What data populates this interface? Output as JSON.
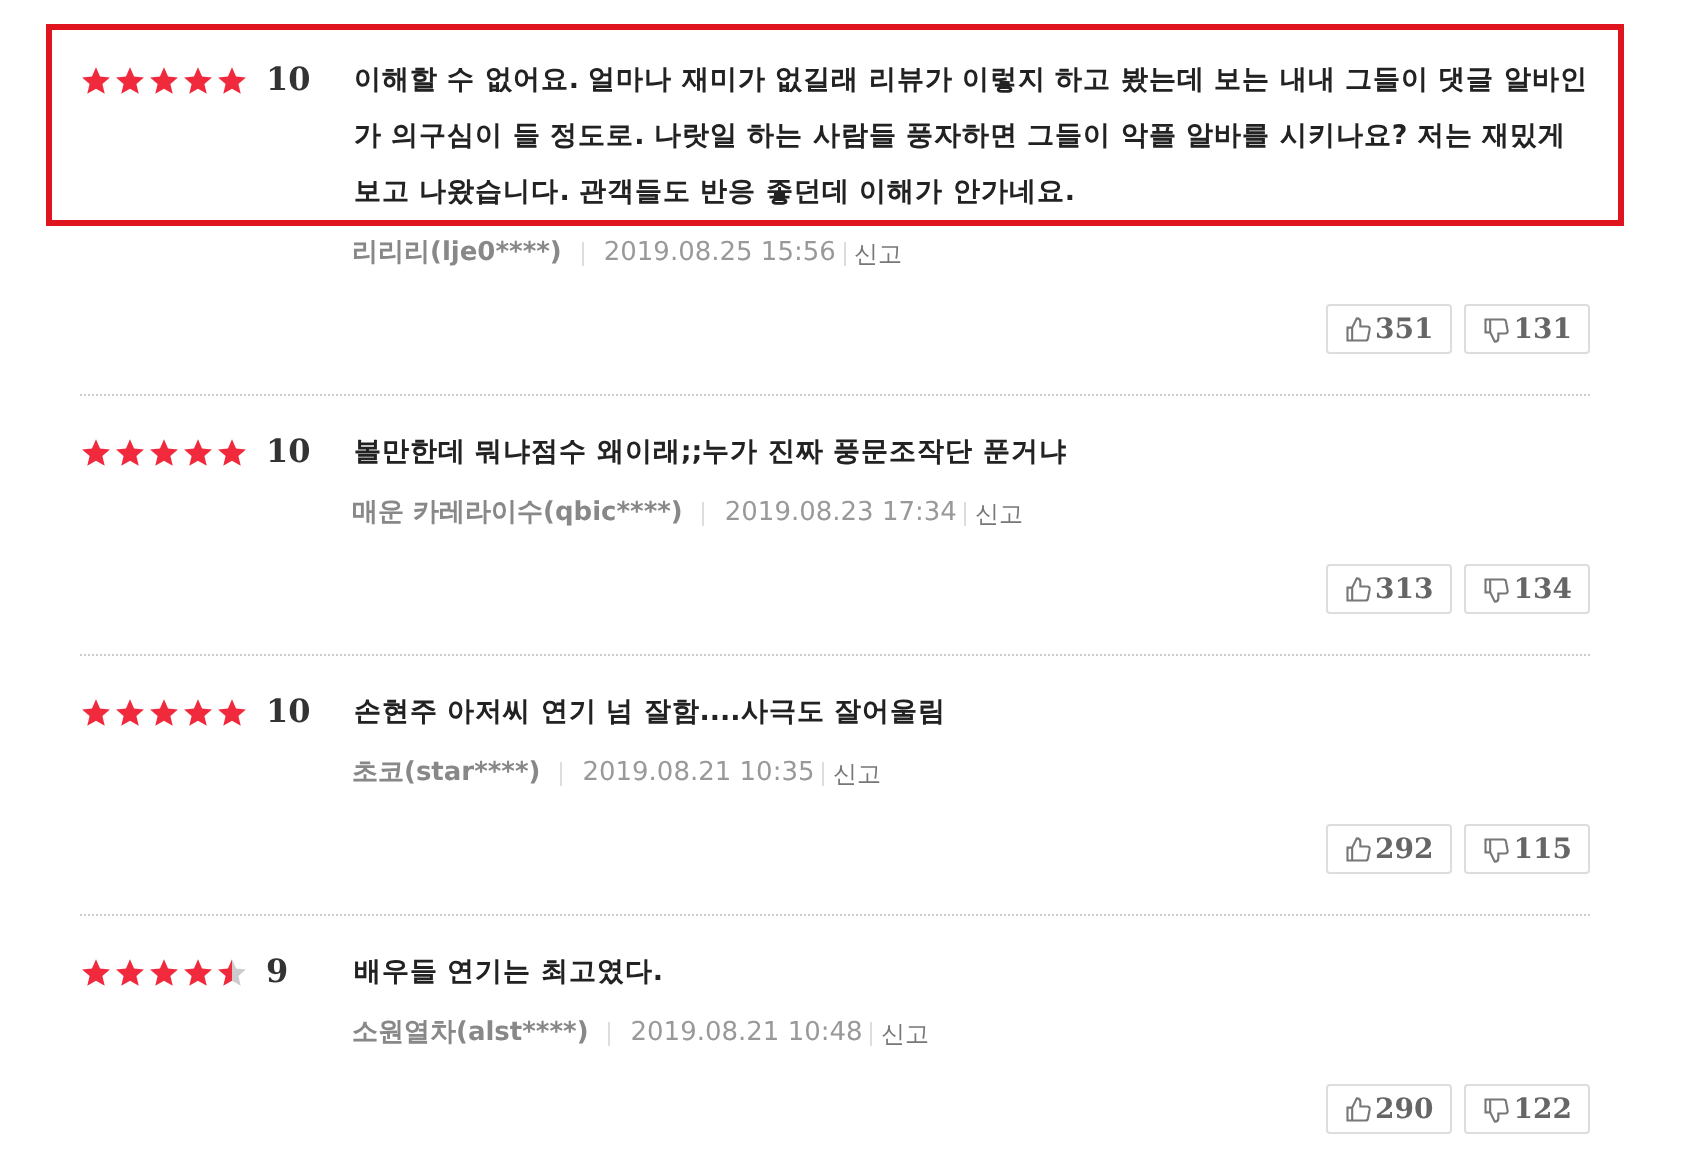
{
  "reviews": [
    {
      "stars": 5,
      "score": "10",
      "highlighted": true,
      "text": "이해할 수 없어요. 얼마나 재미가 없길래 리뷰가 이렇지 하고 봤는데 보는 내내 그들이 댓글 알바인가 의구심이 들 정도로. 나랏일 하는 사람들 풍자하면 그들이 악플 알바를 시키나요? 저는 재밌게 보고 나왔습니다. 관객들도 반응 좋던데 이해가 안가네요.",
      "author": "리리리(lje0****)",
      "date": "2019.08.25 15:56",
      "report": "신고",
      "likes": "351",
      "dislikes": "131"
    },
    {
      "stars": 5,
      "score": "10",
      "highlighted": false,
      "text": "볼만한데 뭐냐점수 왜이래;;누가 진짜 풍문조작단 푼거냐",
      "author": "매운 카레라이수(qbic****)",
      "date": "2019.08.23 17:34",
      "report": "신고",
      "likes": "313",
      "dislikes": "134"
    },
    {
      "stars": 5,
      "score": "10",
      "highlighted": false,
      "text": "손현주 아저씨 연기 넘 잘함....사극도 잘어울림",
      "author": "초코(star****)",
      "date": "2019.08.21 10:35",
      "report": "신고",
      "likes": "292",
      "dislikes": "115"
    },
    {
      "stars": 4.5,
      "score": "9",
      "highlighted": false,
      "text": "배우들 연기는 최고였다.",
      "author": "소원열차(alst****)",
      "date": "2019.08.21 10:48",
      "report": "신고",
      "likes": "290",
      "dislikes": "122"
    }
  ]
}
